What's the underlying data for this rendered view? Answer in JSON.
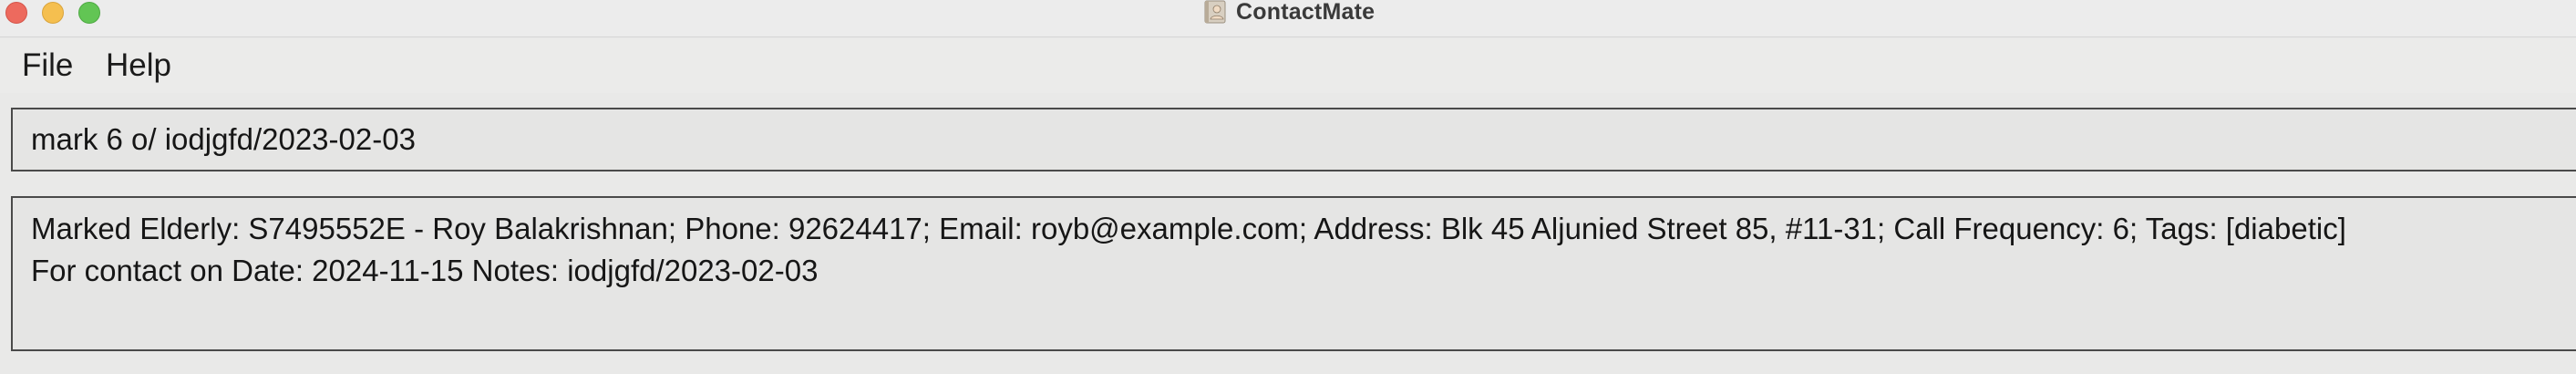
{
  "window": {
    "title": "ContactMate",
    "controls": [
      "close",
      "minimize",
      "zoom"
    ],
    "icon": "contact-book-icon"
  },
  "menu": {
    "items": [
      {
        "label": "File"
      },
      {
        "label": "Help"
      }
    ]
  },
  "command_box": {
    "value": "mark 6 o/ iodjgfd/2023-02-03"
  },
  "result_display": {
    "lines": [
      "Marked Elderly: S7495552E - Roy Balakrishnan; Phone: 92624417; Email: royb@example.com; Address: Blk 45 Aljunied Street 85, #11-31; Call Frequency: 6; Tags: [diabetic]",
      "For contact on Date: 2024-11-15 Notes: iodjgfd/2023-02-03"
    ]
  },
  "colors": {
    "close": "#ed6a5e",
    "minimize": "#f5bf4f",
    "zoom": "#62c554",
    "background": "#e9e9e8",
    "border": "#4a4a4a"
  }
}
